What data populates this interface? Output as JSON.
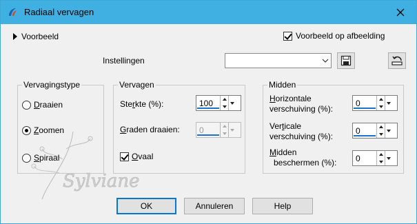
{
  "window": {
    "title": "Radiaal vervagen"
  },
  "preview": {
    "toggle_label": "Voorbeeld",
    "on_image_label": "Voorbeeld op afbeelding",
    "on_image_checked": true
  },
  "settings": {
    "label": "Instellingen",
    "preset_value": ""
  },
  "blur_type": {
    "title": "Vervagingstype",
    "options": [
      {
        "label_u": "D",
        "label_rest": "raaien",
        "checked": false
      },
      {
        "label_u": "Z",
        "label_rest": "oomen",
        "checked": true
      },
      {
        "label_u": "S",
        "label_rest": "piraal",
        "checked": false
      }
    ]
  },
  "blur": {
    "title": "Vervagen",
    "strength_label_pre": "Ste",
    "strength_label_u": "r",
    "strength_label_post": "kte (%):",
    "strength_value": "100",
    "degrees_label_u": "G",
    "degrees_label_post": "raden draaien:",
    "degrees_value": "0",
    "oval_label_u": "O",
    "oval_label_post": "vaal",
    "oval_checked": true
  },
  "center": {
    "title": "Midden",
    "horizontal_label_u": "H",
    "horizontal_label_1": "orizontale",
    "horizontal_label_2": "verschuiving (%):",
    "horizontal_value": "0",
    "vertical_label_pre": "Ver",
    "vertical_label_u": "t",
    "vertical_label_post": "icale",
    "vertical_label_2": "verschuiving (%):",
    "vertical_value": "0",
    "protect_label_u": "M",
    "protect_label_1": "idden",
    "protect_label_2": "beschermen (%):",
    "protect_value": "0"
  },
  "buttons": {
    "ok": "OK",
    "cancel": "Annuleren",
    "help": "Help"
  },
  "watermark": {
    "text": "Sylviane"
  },
  "colors": {
    "titlebar": "#3fb0e1",
    "accent": "#0078d7"
  }
}
